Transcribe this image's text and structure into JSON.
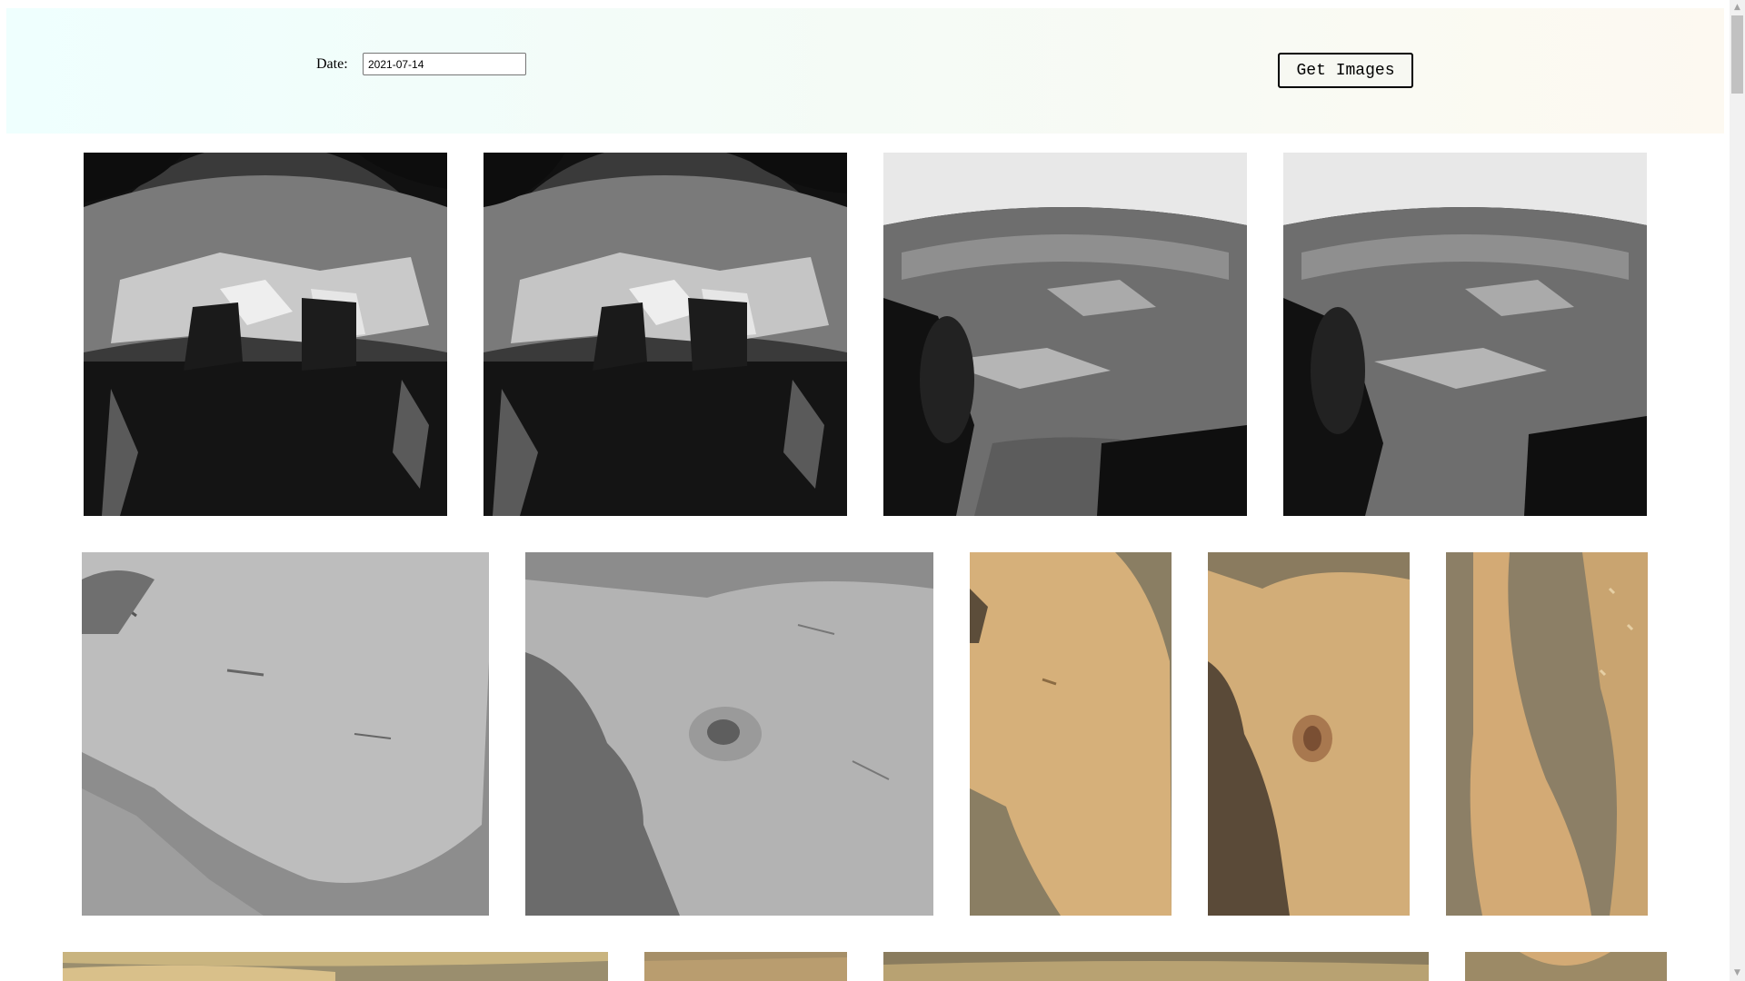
{
  "form": {
    "date_label": "Date:",
    "date_value": "2021-07-14",
    "submit_label": "Get Images"
  },
  "gallery": {
    "row1": [
      "hazcam-image-1",
      "hazcam-image-2",
      "hazcam-image-3",
      "hazcam-image-4"
    ],
    "row2": [
      "closeup-image-1",
      "closeup-image-2",
      "closeup-image-3",
      "closeup-image-4",
      "closeup-image-5"
    ],
    "row3": [
      "partial-image-1",
      "partial-image-2",
      "partial-image-3",
      "partial-image-4"
    ]
  },
  "colors": {
    "header_gradient_start": "#effffe",
    "header_gradient_end": "#fdf9f1",
    "mars_tan": "#d6b07a",
    "mars_shadow": "#8a7b5f",
    "gray_rock": "#b9b9b9"
  },
  "scrollbar": {
    "up_icon": "▲",
    "down_icon": "▼"
  }
}
